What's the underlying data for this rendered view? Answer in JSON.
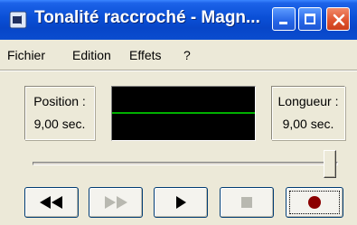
{
  "window": {
    "title": "Tonalité raccroché - Magn..."
  },
  "menu": {
    "items": [
      "Fichier",
      "Edition",
      "Effets",
      "?"
    ]
  },
  "position": {
    "label": "Position :",
    "value": "9,00 sec."
  },
  "length": {
    "label": "Longueur :",
    "value": "9,00 sec."
  },
  "seek": {
    "value_fraction": 1.0
  },
  "colors": {
    "titlebar": "#0a4fd6",
    "trace": "#00b000",
    "record": "#8b0000",
    "disabled": "#a0a0a0"
  },
  "controls": {
    "rewind": "rewind-icon",
    "fast_forward": "fast-forward-icon",
    "play": "play-icon",
    "stop": "stop-icon",
    "record": "record-icon"
  }
}
